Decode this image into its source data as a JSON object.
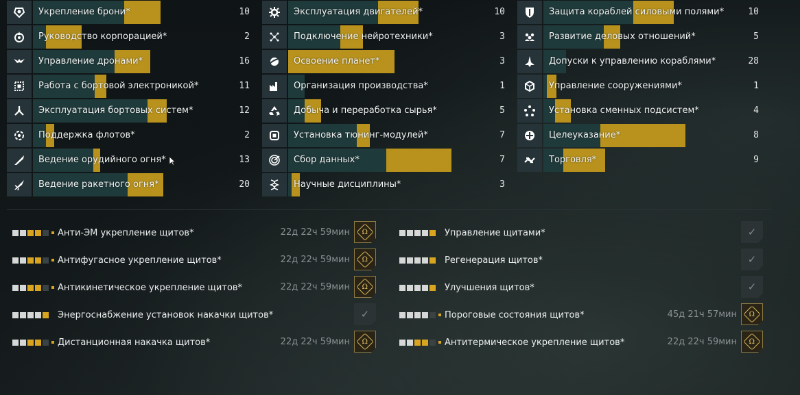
{
  "groups": [
    [
      {
        "icon": "armor-icon",
        "name": "Укрепление брони*",
        "count": "10",
        "bar": 0.78,
        "fill_start": 0.56
      },
      {
        "icon": "corporation-icon",
        "name": "Руководство корпорацией*",
        "count": "2",
        "bar": 0.3,
        "fill_start": 0.08
      },
      {
        "icon": "drone-icon",
        "name": "Управление дронами*",
        "count": "16",
        "bar": 0.72,
        "fill_start": 0.5
      },
      {
        "icon": "electronics-icon",
        "name": "Работа с бортовой электроникой*",
        "count": "11",
        "bar": 0.45,
        "fill_start": 0.38
      },
      {
        "icon": "engineering-icon",
        "name": "Эксплуатация бортовых систем*",
        "count": "12",
        "bar": 0.82,
        "fill_start": 0.7
      },
      {
        "icon": "fleet-icon",
        "name": "Поддержка флотов*",
        "count": "2",
        "bar": 0.13,
        "fill_start": 0.08
      },
      {
        "icon": "gunnery-icon",
        "name": "Ведение орудийного огня*",
        "count": "13",
        "bar": 0.41,
        "fill_start": 0.37
      },
      {
        "icon": "missile-icon",
        "name": "Ведение ракетного огня*",
        "count": "20",
        "bar": 0.8,
        "fill_start": 0.58
      }
    ],
    [
      {
        "icon": "engine-icon",
        "name": "Эксплуатация двигателей*",
        "count": "10",
        "bar": 0.8,
        "fill_start": 0.55
      },
      {
        "icon": "neural-icon",
        "name": "Подключение нейротехники*",
        "count": "3",
        "bar": 0.46,
        "fill_start": 0.32
      },
      {
        "icon": "planet-icon",
        "name": "Освоение планет*",
        "count": "3",
        "bar": 0.65,
        "fill_start": 0.0
      },
      {
        "icon": "production-icon",
        "name": "Организация производства*",
        "count": "1",
        "bar": 0.1,
        "fill_start": 0.1
      },
      {
        "icon": "recycle-icon",
        "name": "Добыча и переработка сырья*",
        "count": "5",
        "bar": 0.2,
        "fill_start": 0.1
      },
      {
        "icon": "rigging-icon",
        "name": "Установка тюнинг-модулей*",
        "count": "7",
        "bar": 0.5,
        "fill_start": 0.42
      },
      {
        "icon": "scanning-icon",
        "name": "Сбор данных*",
        "count": "7",
        "bar": 1.0,
        "fill_start": 0.6
      },
      {
        "icon": "science-icon",
        "name": "Научные дисциплины*",
        "count": "3",
        "bar": 0.07,
        "fill_start": 0.02
      }
    ],
    [
      {
        "icon": "shield-icon",
        "name": "Защита кораблей силовыми полями*",
        "count": "10",
        "bar": 0.8,
        "fill_start": 0.55
      },
      {
        "icon": "social-icon",
        "name": "Развитие деловых отношений*",
        "count": "5",
        "bar": 0.47,
        "fill_start": 0.37
      },
      {
        "icon": "ship-icon",
        "name": "Допуски к управлению кораблями*",
        "count": "28",
        "bar": 0.14,
        "fill_start": 0.14
      },
      {
        "icon": "structure-icon",
        "name": "Управление сооружениями*",
        "count": "1",
        "bar": 0.08,
        "fill_start": 0.02
      },
      {
        "icon": "subsystem-icon",
        "name": "Установка сменных подсистем*",
        "count": "4",
        "bar": 0.17,
        "fill_start": 0.07
      },
      {
        "icon": "targeting-icon",
        "name": "Целеуказание*",
        "count": "8",
        "bar": 0.87,
        "fill_start": 0.35
      },
      {
        "icon": "trade-icon",
        "name": "Торговля*",
        "count": "9",
        "bar": 0.38,
        "fill_start": 0.12
      }
    ]
  ],
  "skills": [
    [
      {
        "name": "Анти-ЭМ укрепление щитов*",
        "levels": [
          "t",
          "t",
          "g",
          "g",
          "e"
        ],
        "dot": true,
        "time": "22д 22ч 59мин",
        "action": "omega"
      },
      {
        "name": "Антифугасное укрепление щитов*",
        "levels": [
          "t",
          "t",
          "g",
          "g",
          "e"
        ],
        "dot": true,
        "time": "22д 22ч 59мин",
        "action": "omega"
      },
      {
        "name": "Антикинетическое укрепление щитов*",
        "levels": [
          "t",
          "t",
          "g",
          "g",
          "e"
        ],
        "dot": true,
        "time": "22д 22ч 59мин",
        "action": "omega"
      },
      {
        "name": "Энергоснабжение установок накачки щитов*",
        "levels": [
          "t",
          "t",
          "t",
          "t",
          "g"
        ],
        "dot": false,
        "time": "",
        "action": "check"
      },
      {
        "name": "Дистанционная накачка щитов*",
        "levels": [
          "t",
          "t",
          "g",
          "g",
          "e"
        ],
        "dot": true,
        "time": "22д 22ч 59мин",
        "action": "omega"
      }
    ],
    [
      {
        "name": "Управление щитами*",
        "levels": [
          "t",
          "t",
          "t",
          "t",
          "g"
        ],
        "dot": false,
        "time": "",
        "action": "check"
      },
      {
        "name": "Регенерация щитов*",
        "levels": [
          "t",
          "t",
          "t",
          "t",
          "g"
        ],
        "dot": false,
        "time": "",
        "action": "check"
      },
      {
        "name": "Улучшения щитов*",
        "levels": [
          "t",
          "t",
          "t",
          "t",
          "g"
        ],
        "dot": false,
        "time": "",
        "action": "check"
      },
      {
        "name": "Пороговые состояния щитов*",
        "levels": [
          "t",
          "t",
          "t",
          "t",
          "e"
        ],
        "dot": true,
        "time": "45д 21ч 57мин",
        "action": "omega"
      },
      {
        "name": "Антитермическое укрепление щитов*",
        "levels": [
          "t",
          "t",
          "g",
          "g",
          "e"
        ],
        "dot": true,
        "time": "22д 22ч 59мин",
        "action": "omega"
      }
    ]
  ],
  "omega_glyph": "Ω",
  "check_glyph": "✓",
  "colors": {
    "bar_bg": "#1f3a3b",
    "bar_fill": "#b8921c",
    "accent": "#d9a521"
  }
}
